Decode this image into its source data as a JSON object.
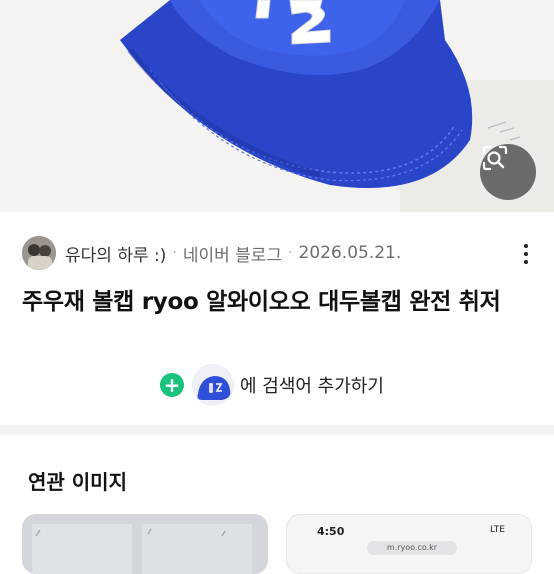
{
  "hero": {
    "image_alt": "blue baseball cap with white 12 patch",
    "lens_button": "lens-search-icon"
  },
  "source": {
    "author": "유다의 하루 :)",
    "separator": "·",
    "site": "네이버 블로그",
    "date": "2026.05.21.",
    "more_icon": "more-vertical-icon"
  },
  "result": {
    "title": "주우재 볼캡 ryoo 알와이오오 대두볼캡 완전 취저"
  },
  "add_to_search": {
    "label": "에 검색어 추가하기",
    "plus_icon": "plus-icon"
  },
  "related": {
    "heading": "연관 이미지",
    "card2_time": "4:50",
    "card2_status": "LTE",
    "card2_url": "m.ryoo.co.kr"
  },
  "colors": {
    "cap_blue": "#2f4fd6",
    "plus_green": "#19c37d"
  }
}
